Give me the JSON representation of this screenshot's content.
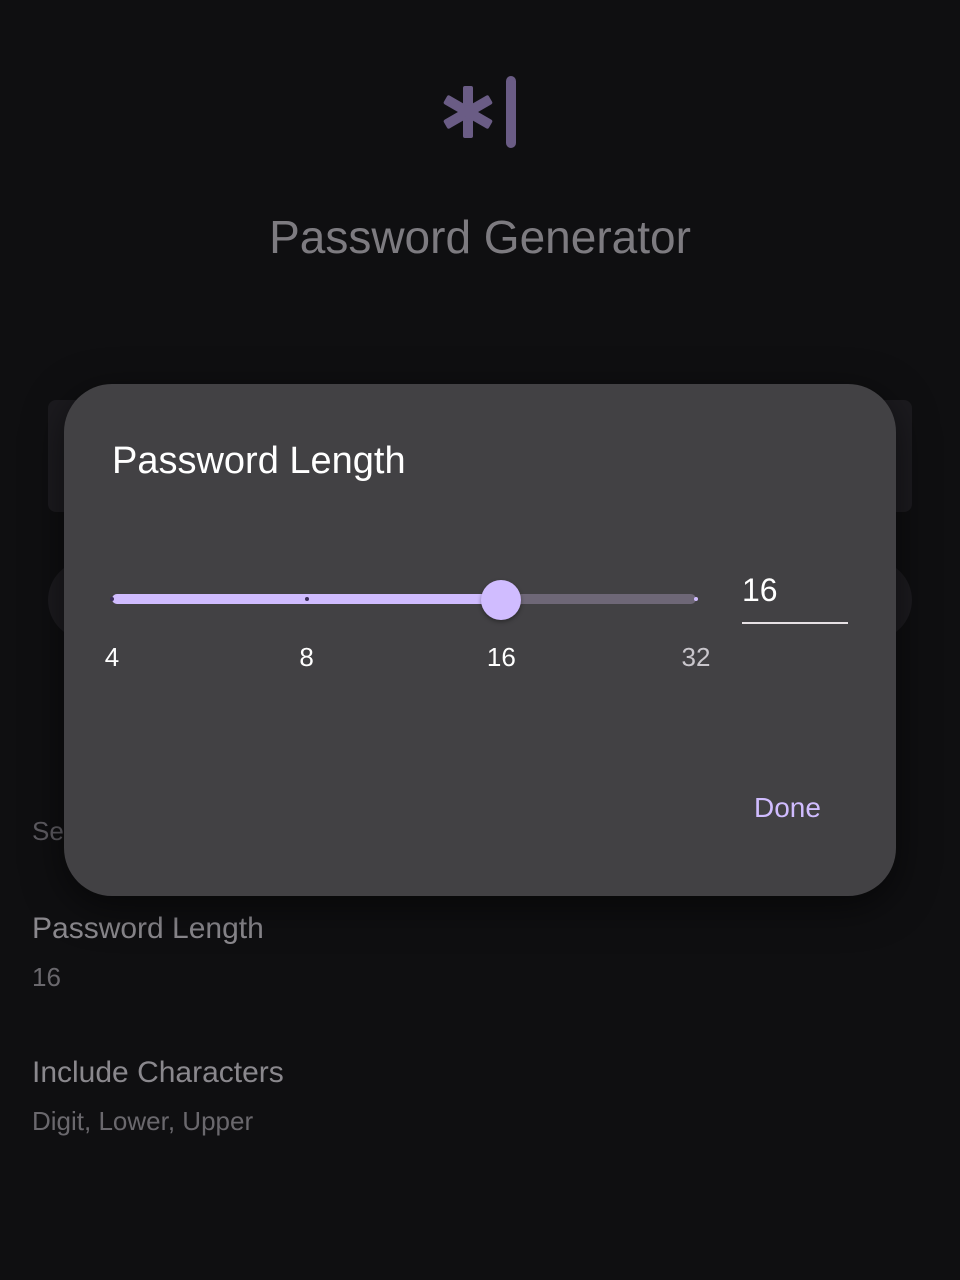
{
  "app": {
    "title": "Password Generator",
    "logo_icon": "asterisk-cursor-icon",
    "accent_color": "#d0bcff"
  },
  "settings": {
    "section_label": "Se",
    "password_length": {
      "title": "Password Length",
      "value": "16"
    },
    "include_characters": {
      "title": "Include Characters",
      "value": "Digit, Lower, Upper"
    }
  },
  "dialog": {
    "title": "Password Length",
    "slider": {
      "ticks": [
        "4",
        "8",
        "16",
        "32"
      ],
      "selected_index": 2
    },
    "length_value": "16",
    "done_label": "Done"
  }
}
